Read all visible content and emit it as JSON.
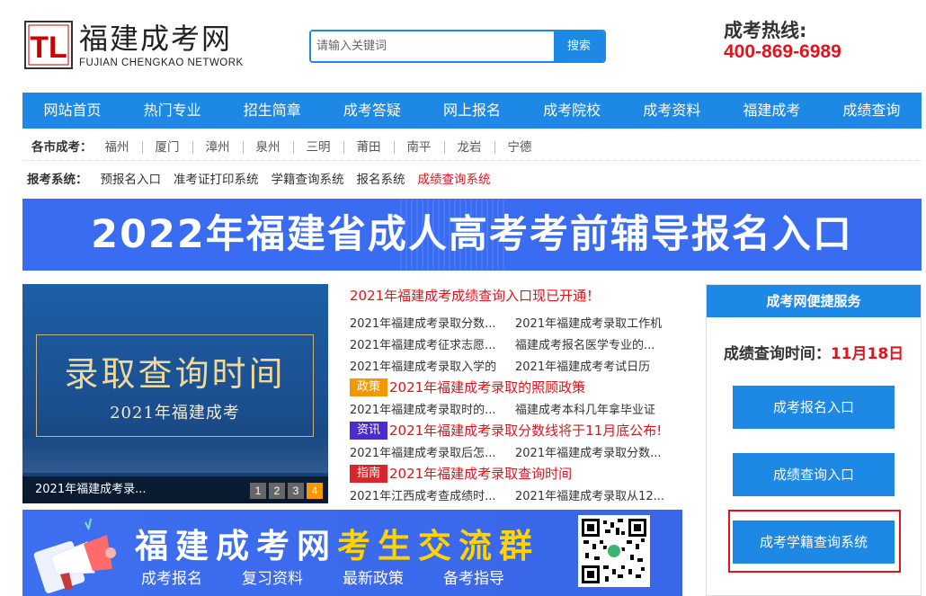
{
  "header": {
    "logo_mark": "TL",
    "logo_cn": "福建成考网",
    "logo_en": "FUJIAN CHENGKAO NETWORK",
    "search_placeholder": "请输入关键词",
    "search_button": "搜索",
    "hotline_label": "成考热线:",
    "hotline_number": "400-869-6989"
  },
  "nav": {
    "items": [
      "网站首页",
      "热门专业",
      "招生简章",
      "成考答疑",
      "网上报名",
      "成考院校",
      "成考资料",
      "福建成考",
      "成绩查询"
    ]
  },
  "cities": {
    "label": "各市成考：",
    "items": [
      "福州",
      "厦门",
      "漳州",
      "泉州",
      "三明",
      "莆田",
      "南平",
      "龙岩",
      "宁德"
    ]
  },
  "systems": {
    "label": "报考系统：",
    "items": [
      "预报名入口",
      "准考证打印系统",
      "学籍查询系统",
      "报名系统",
      "成绩查询系统"
    ]
  },
  "banner": {
    "text": "2022年福建省成人高考考前辅导报名入口"
  },
  "slideshow": {
    "title": "录取查询时间",
    "subtitle": "2021年福建成考",
    "caption": "2021年福建成考录...",
    "pages": [
      "1",
      "2",
      "3",
      "4"
    ],
    "active_page": "4"
  },
  "news": {
    "headline": "2021年福建成考成绩查询入口现已开通！",
    "rows": [
      [
        "2021年福建成考录取分数...",
        "2021年福建成考录取工作机"
      ],
      [
        "2021年福建成考征求志愿...",
        "福建成考报名医学专业的..."
      ],
      [
        "2021年福建成考录取入学的",
        "2021年福建成考考试日历"
      ]
    ],
    "tag1": {
      "tag": "政策",
      "text": "2021年福建成考录取的照顾政策"
    },
    "rows2": [
      [
        "2021年福建成考录取时的...",
        "福建成考本科几年拿毕业证"
      ]
    ],
    "tag2": {
      "tag": "资讯",
      "text": "2021年福建成考录取分数线将于11月底公布!"
    },
    "rows3": [
      [
        "2021年福建成考录取后怎...",
        "2021年福建成考录取分数..."
      ]
    ],
    "tag3": {
      "tag": "指南",
      "text": "2021年福建成考录取查询时间"
    },
    "rows4": [
      [
        "2021年江西成考查成绩时...",
        "2021年福建成考录取从12..."
      ]
    ]
  },
  "service": {
    "header": "成考网便捷服务",
    "time_label": "成绩查询时间：",
    "time_value": "11月18日",
    "buttons": [
      "成考报名入口",
      "成绩查询入口",
      "成考学籍查询系统"
    ]
  },
  "lower_banner": {
    "title_white": "福建成考网",
    "title_yellow": "考生交流群",
    "links": [
      "成考报名",
      "复习资料",
      "最新政策",
      "备考指导"
    ]
  },
  "colors": {
    "primary": "#1e88e5",
    "accent_red": "#e0141e",
    "banner_blue": "#3a6cf2"
  }
}
